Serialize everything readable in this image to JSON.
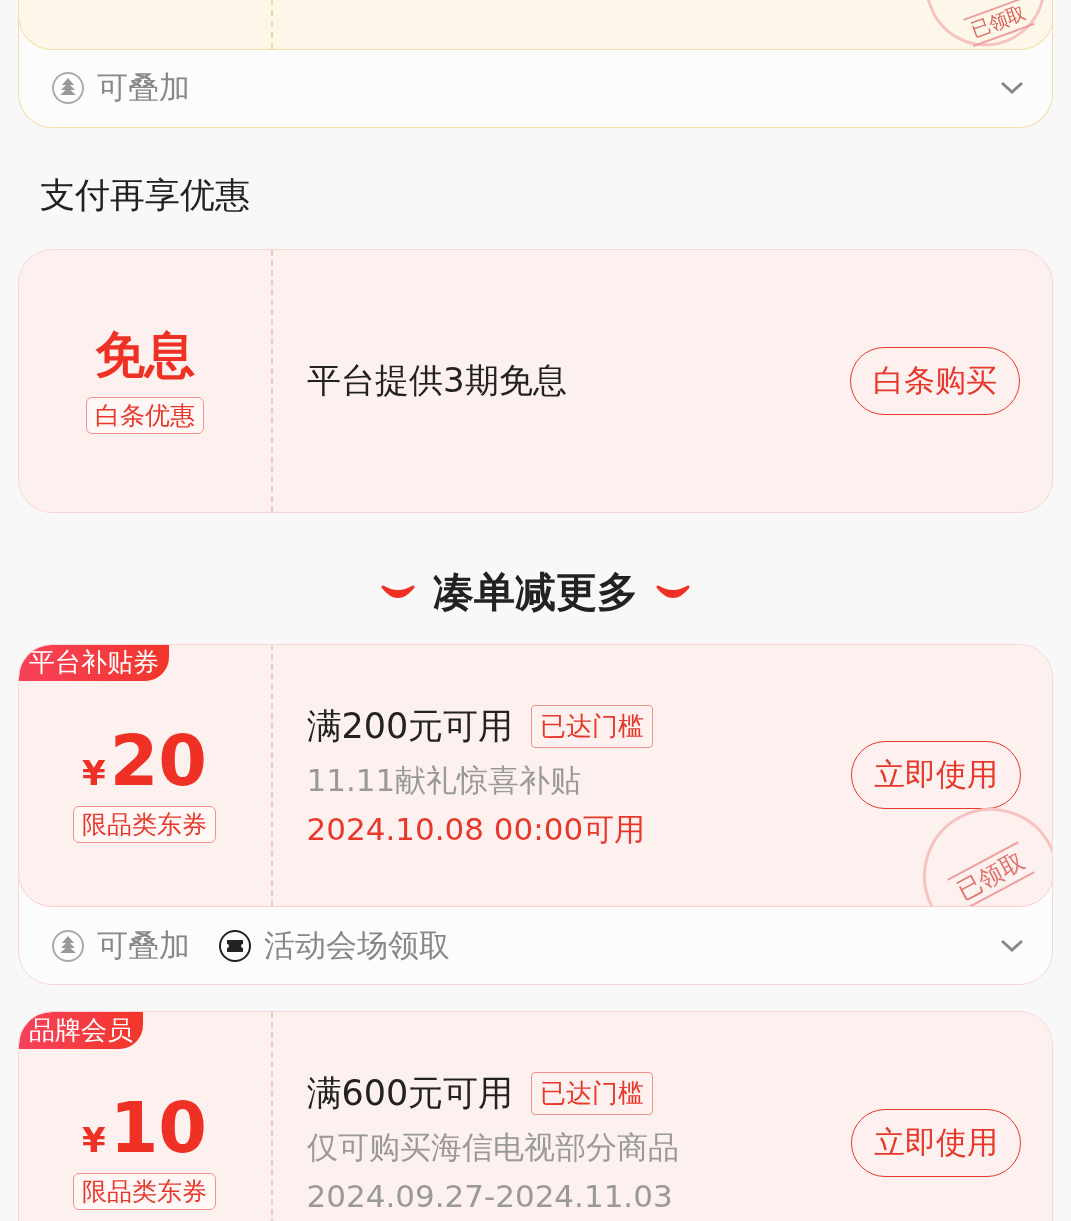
{
  "top_coupon": {
    "stamp": "已领取",
    "tags": [
      {
        "kind": "stack",
        "label": "可叠加"
      }
    ]
  },
  "payment_section": {
    "title": "支付再享优惠",
    "offer": {
      "headline": "免息",
      "badge": "白条优惠",
      "description": "平台提供3期免息",
      "button": "白条购买"
    }
  },
  "more_section": {
    "title": "凑单减更多",
    "coupons": [
      {
        "ribbon": "平台补贴券",
        "currency": "¥",
        "amount": "20",
        "badge": "限品类东券",
        "condition": "满200元可用",
        "threshold": "已达门槛",
        "note": "11.11献礼惊喜补贴",
        "date": "2024.10.08 00:00可用",
        "date_highlight": true,
        "button": "立即使用",
        "stamp": "已领取",
        "tags": [
          {
            "kind": "stack",
            "label": "可叠加"
          },
          {
            "kind": "venue",
            "label": "活动会场领取"
          }
        ]
      },
      {
        "ribbon": "品牌会员",
        "currency": "¥",
        "amount": "10",
        "badge": "限品类东券",
        "condition": "满600元可用",
        "threshold": "已达门槛",
        "note": "仅可购买海信电视部分商品",
        "date": "2024.09.27-2024.11.03",
        "date_highlight": false,
        "button": "立即使用"
      }
    ]
  }
}
